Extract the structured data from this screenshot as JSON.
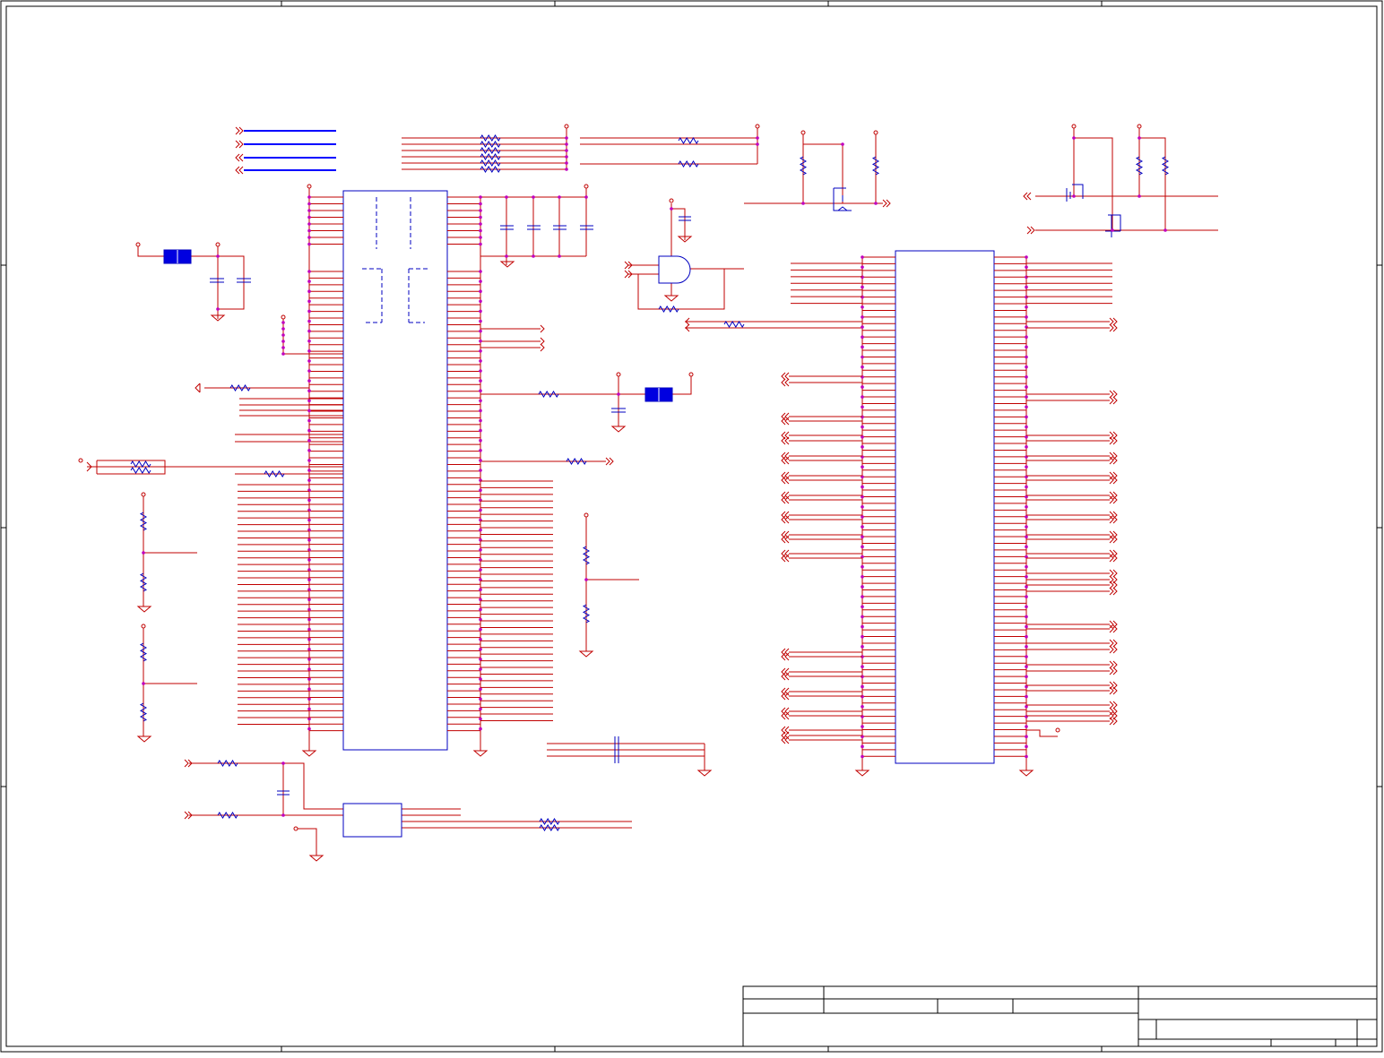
{
  "colors": {
    "border": "#000000",
    "wire": "#c00000",
    "component": "#0000c0",
    "junction": "#c000c0",
    "bus": "#0000ff",
    "ferrite_fill": "#0000e0"
  },
  "title_block": {
    "company": "",
    "title": "",
    "size": "",
    "document_number": "",
    "rev": "",
    "date": "",
    "sheet": ""
  }
}
